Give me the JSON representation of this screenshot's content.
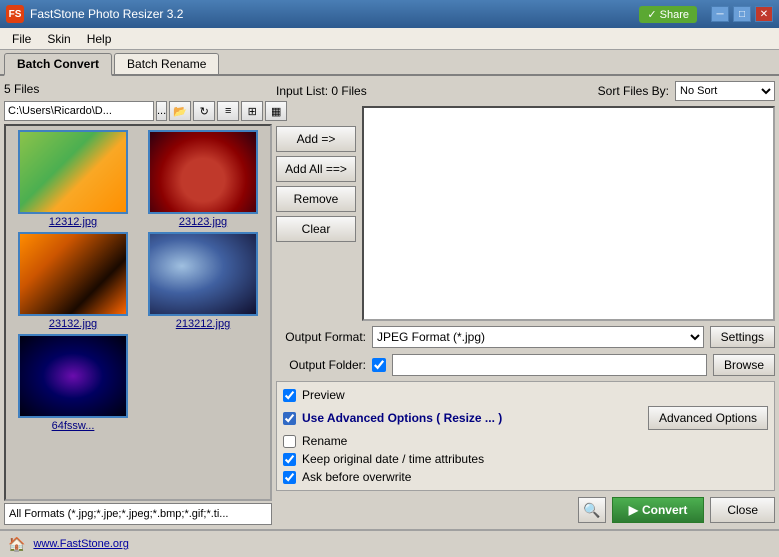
{
  "titleBar": {
    "appName": "FastStone Photo Resizer 3.2",
    "vshare": "✓ Share",
    "minimize": "─",
    "maximize": "□",
    "close": "✕"
  },
  "menu": {
    "items": [
      "File",
      "Skin",
      "Help"
    ]
  },
  "tabs": {
    "batchConvert": "Batch Convert",
    "batchRename": "Batch Rename"
  },
  "leftPanel": {
    "fileCount": "5 Files",
    "path": "C:\\Users\\Ricardo\\D...",
    "pathBtn": "...",
    "formatBar": "All Formats (*.jpg;*.jpe;*.jpeg;*.bmp;*.gif;*.ti..."
  },
  "images": [
    {
      "label": "12312.jpg",
      "style": "bart"
    },
    {
      "label": "23123.jpg",
      "style": "cherry"
    },
    {
      "label": "23132.jpg",
      "style": "tiger"
    },
    {
      "label": "213212.jpg",
      "style": "wolf"
    },
    {
      "label": "64fssw...",
      "style": "stars"
    }
  ],
  "inputList": {
    "label": "Input List:  0 Files",
    "sortLabel": "Sort Files By:",
    "sortValue": "No Sort"
  },
  "actionButtons": {
    "add": "Add =>",
    "addAll": "Add All ==>",
    "remove": "Remove",
    "clear": "Clear"
  },
  "outputFormat": {
    "label": "Output Format:",
    "value": "JPEG Format (*.jpg)",
    "settingsBtn": "Settings"
  },
  "outputFolder": {
    "label": "Output Folder:",
    "browseBtn": "Browse"
  },
  "options": {
    "previewLabel": "Preview",
    "previewChecked": true,
    "advancedLabel": "Use Advanced Options ( Resize ... )",
    "advancedChecked": true,
    "advancedBtn": "Advanced Options",
    "renameLabel": "Rename",
    "renameChecked": false,
    "keepDateLabel": "Keep original date / time attributes",
    "keepDateChecked": true,
    "overwriteLabel": "Ask before overwrite",
    "overwriteChecked": true
  },
  "bottomButtons": {
    "convertLabel": "Convert",
    "closeLabel": "Close"
  },
  "statusBar": {
    "url": "www.FastStone.org"
  }
}
